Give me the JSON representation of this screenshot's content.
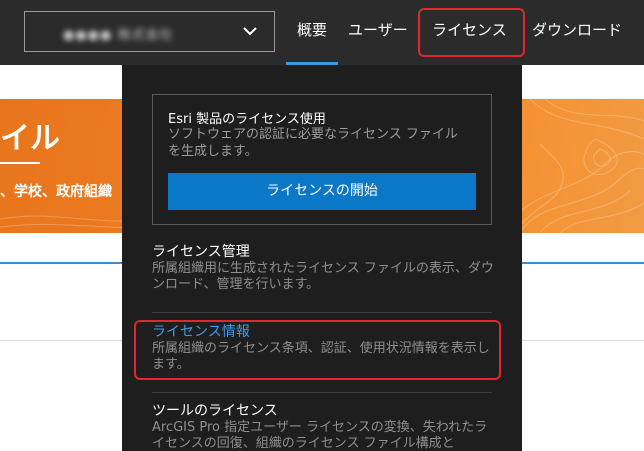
{
  "header": {
    "org_name": "●●●● 株式会社",
    "nav": {
      "overview": "概要",
      "users": "ユーザー",
      "licenses": "ライセンス",
      "download": "ダウンロード"
    }
  },
  "banner": {
    "title": "イル",
    "subtitle": "、学校、政府組織"
  },
  "dropdown": {
    "card": {
      "title": "Esri 製品のライセンス使用",
      "description": "ソフトウェアの認証に必要なライセンス ファイルを生成します。",
      "button": "ライセンスの開始"
    },
    "items": [
      {
        "title": "ライセンス管理",
        "description": "所属組織用に生成されたライセンス ファイルの表示、ダウンロード、管理を行います。"
      },
      {
        "title": "ライセンス情報",
        "description": "所属組織のライセンス条項、認証、使用状況情報を表示します。"
      },
      {
        "title": "ツールのライセンス",
        "description": "ArcGIS Pro 指定ユーザー ライセンスの変換、失われたライセンスの回復、組織のライセンス ファイル構成と"
      }
    ]
  },
  "colors": {
    "nav_bg": "#2b2b2b",
    "dropdown_bg": "#1e1e1e",
    "accent_blue": "#0a78c6",
    "link_blue": "#3f9be3",
    "banner_orange": "#f07f26",
    "highlight_red": "#e0262e"
  }
}
